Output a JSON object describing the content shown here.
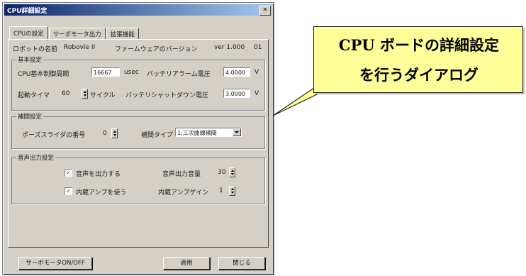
{
  "window": {
    "title": "CPU詳細設定",
    "close_label": "×"
  },
  "tabs": [
    {
      "label": "CPUの設定"
    },
    {
      "label": "サーボモータ出力"
    },
    {
      "label": "拡張機能"
    }
  ],
  "info": {
    "robot_name_label": "ロボットの名前",
    "robot_name_value": "Robovie II",
    "firmware_label": "ファームウェアのバージョン",
    "firmware_value": "ver 1.000",
    "extra_value": "01"
  },
  "basic_group": {
    "legend": "基本設定",
    "control_period_label": "CPU基本制御周期",
    "control_period_value": "16667",
    "control_period_unit": "usec",
    "battery_alarm_label": "バッテリアラーム電圧",
    "battery_alarm_value": "4.0000",
    "battery_alarm_unit": "V",
    "startup_timer_label": "起動タイマ",
    "startup_timer_value": "60",
    "startup_timer_unit": "サイクル",
    "battery_shutdown_label": "バッテリシャットダウン電圧",
    "battery_shutdown_value": "3.0000",
    "battery_shutdown_unit": "V"
  },
  "interp_group": {
    "legend": "補間設定",
    "pose_slider_label": "ポーズスライダの番号",
    "pose_slider_value": "0",
    "interp_type_label": "補間タイプ",
    "interp_type_value": "1:三次曲線補間"
  },
  "audio_group": {
    "legend": "音声出力設定",
    "output_audio_label": "音声を出力する",
    "output_audio_checked": true,
    "volume_label": "音声出力音量",
    "volume_value": "30",
    "internal_amp_label": "内蔵アンプを使う",
    "internal_amp_checked": true,
    "amp_gain_label": "内蔵アンプゲイン",
    "amp_gain_value": "1"
  },
  "footer": {
    "servo_toggle_label": "サーボモータON/OFF",
    "apply_label": "適用",
    "close_label": "閉じる"
  },
  "callout": {
    "line1": "CPU ボードの詳細設定",
    "line2": "を行うダイアログ"
  }
}
